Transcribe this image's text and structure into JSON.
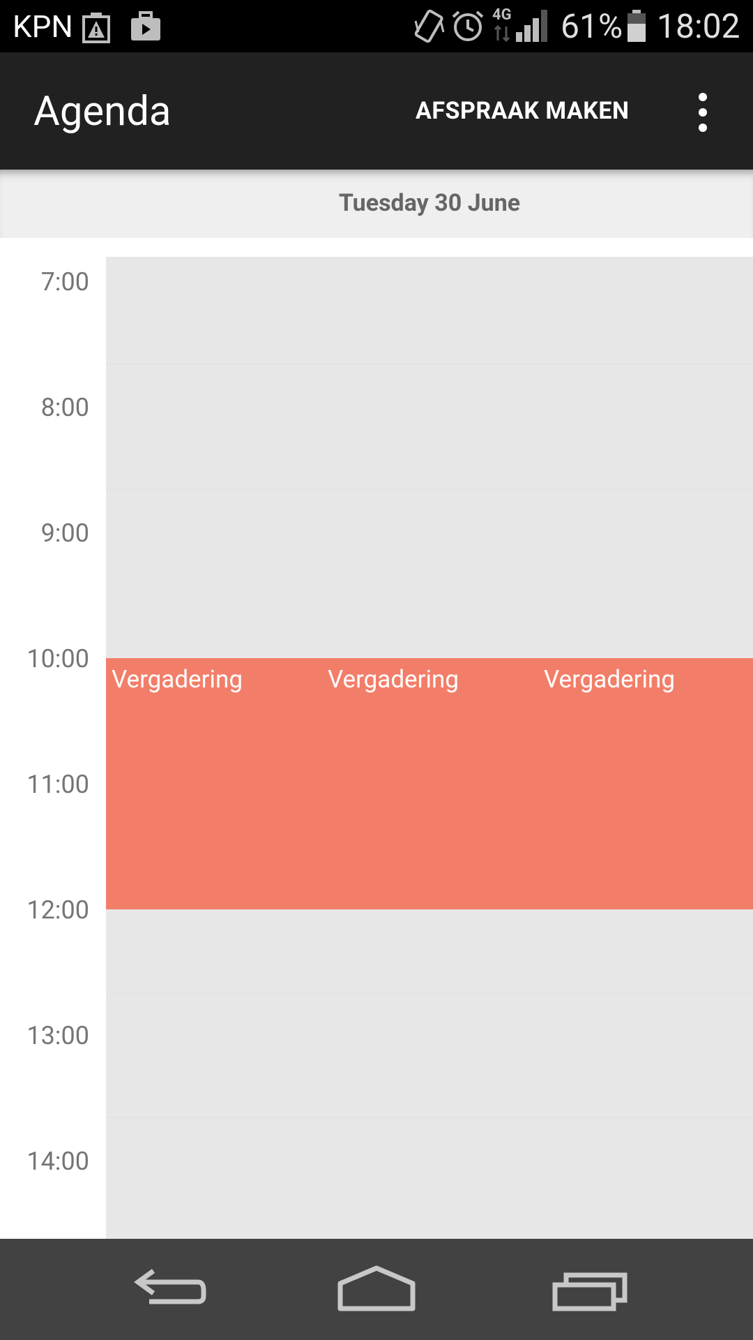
{
  "status_bar": {
    "carrier": "KPN",
    "battery_percent": "61%",
    "time": "18:02",
    "network": "4G",
    "icons": [
      "battery-warning-icon",
      "work-profile-icon",
      "vibrate-icon",
      "alarm-icon",
      "signal-icon",
      "battery-icon"
    ]
  },
  "action_bar": {
    "title": "Agenda",
    "action_label": "AFSPRAAK MAKEN",
    "overflow_icon": "more-vert-icon"
  },
  "date_header": {
    "date": "Tuesday 30 June"
  },
  "calendar": {
    "hours": [
      "7:00",
      "8:00",
      "9:00",
      "10:00",
      "11:00",
      "12:00",
      "13:00",
      "14:00"
    ],
    "events": [
      {
        "title": "Vergadering",
        "start": "10:00",
        "end": "12:00"
      },
      {
        "title": "Vergadering",
        "start": "10:00",
        "end": "12:00"
      },
      {
        "title": "Vergadering",
        "start": "10:00",
        "end": "12:00"
      }
    ],
    "event_color": "#f27e69"
  },
  "nav_bar": {
    "buttons": [
      "back-icon",
      "home-icon",
      "recents-icon"
    ]
  }
}
